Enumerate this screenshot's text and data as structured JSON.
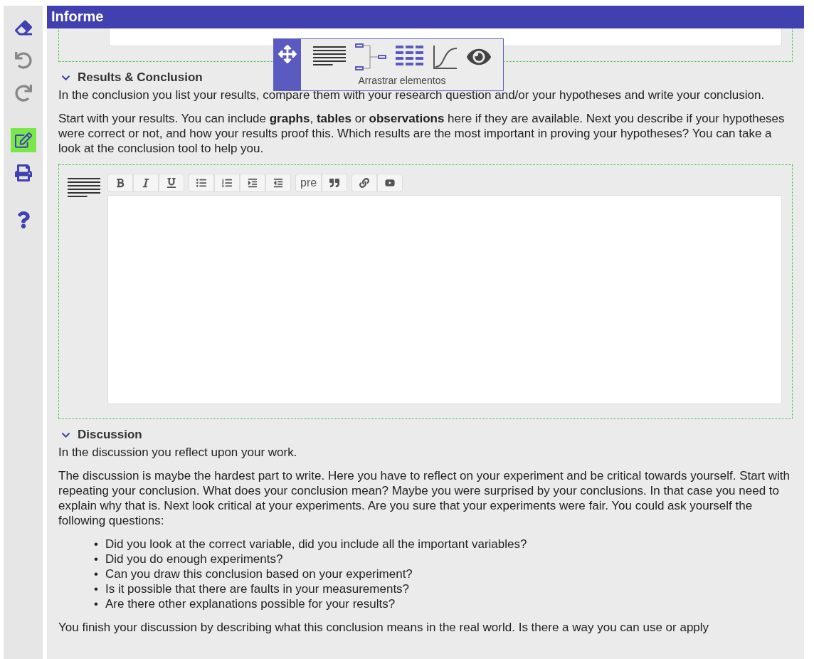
{
  "window": {
    "title": "Informe"
  },
  "sidebar": {
    "tools": [
      {
        "kind": "eraser",
        "selected": false
      },
      {
        "kind": "undo",
        "selected": false
      },
      {
        "kind": "redo",
        "selected": false
      },
      {
        "kind": "edit",
        "selected": true
      },
      {
        "kind": "print",
        "selected": false
      },
      {
        "kind": "help",
        "selected": false
      }
    ]
  },
  "drag_palette": {
    "label": "Arrastrar elementos"
  },
  "sections": [
    {
      "title": "Results & Conclusion",
      "expanded": true,
      "paragraphs": [
        "In the conclusion you list your results, compare them with your research question and/or your hypotheses and write your conclusion.",
        "Start with your results. You can include **graphs**, **tables** or **observations** here if they are available. Next you describe if your hypotheses were correct or not, and how your results proof this. Which results are the most important in proving your hypotheses? You can take a look at the conclusion tool to help you."
      ],
      "editor": {
        "toolbar": [
          [
            {
              "kind": "bold"
            },
            {
              "kind": "italic"
            },
            {
              "kind": "underline"
            }
          ],
          [
            {
              "kind": "bullets"
            },
            {
              "kind": "numbers"
            },
            {
              "kind": "indent"
            },
            {
              "kind": "outdent"
            }
          ],
          [
            {
              "kind": "text",
              "label": "pre"
            },
            {
              "kind": "quote"
            }
          ],
          [
            {
              "kind": "link"
            },
            {
              "kind": "video"
            }
          ]
        ]
      }
    },
    {
      "title": "Discussion",
      "expanded": true,
      "paragraphs": [
        "In the discussion you reflect upon your work.",
        "The discussion is maybe the hardest part to write. Here you have to reflect on your experiment and be critical towards yourself. Start with repeating your conclusion. What does your conclusion mean? Maybe you were surprised by your conclusions. In that case you need to explain why that is. Next look critical at your experiments. Are you sure that your experiments were fair. You could ask yourself the following questions:"
      ],
      "bullet_marker": "•",
      "bullets": [
        "Did you look at the correct variable, did you include all the important variables?",
        "Did you do enough experiments?",
        "Can you draw this conclusion based on your experiment?",
        "Is it possible that there are faults in your measurements?",
        "Are there other explanations possible for your results?"
      ],
      "closing": "You finish your discussion by describing what this conclusion means in the real world. Is there a way you can use or apply"
    }
  ]
}
